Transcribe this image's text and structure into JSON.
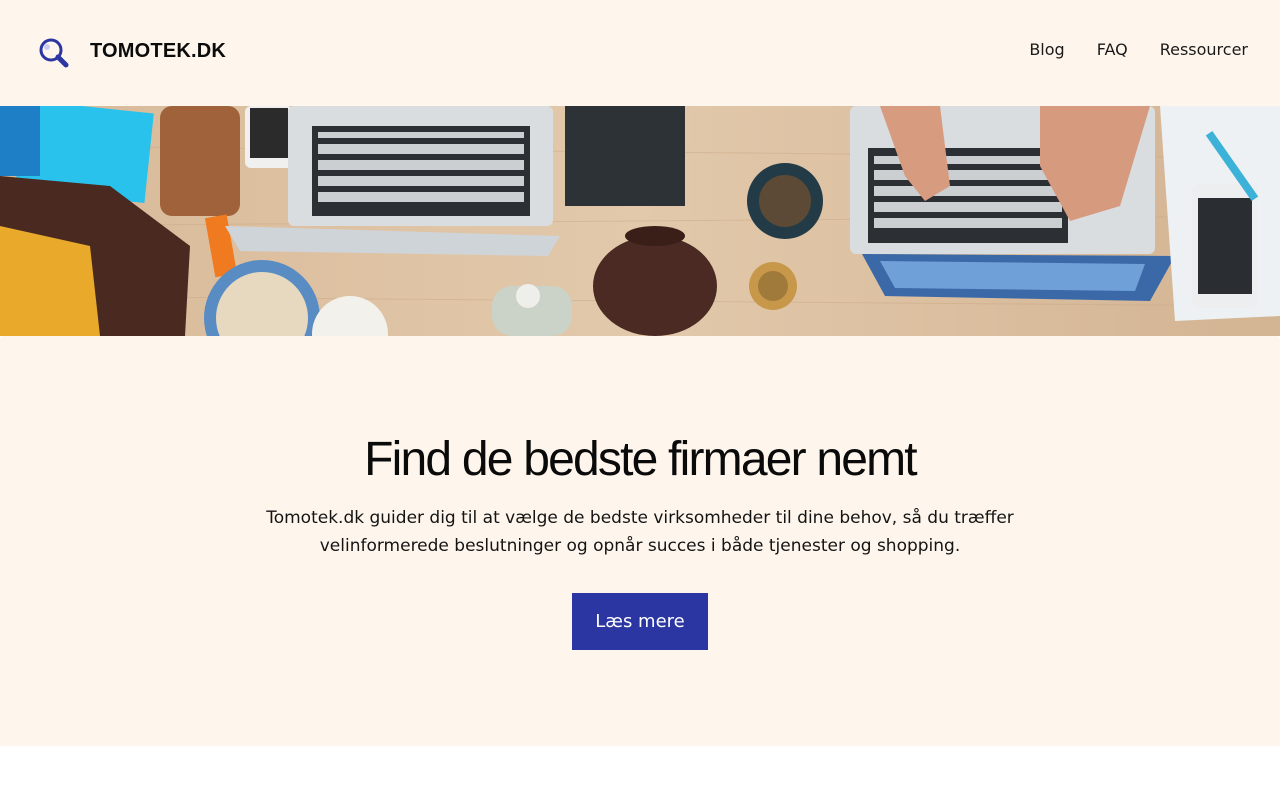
{
  "header": {
    "brand": "TOMOTEK.DK",
    "logo_icon": "magnifier-icon",
    "nav": [
      {
        "label": "Blog"
      },
      {
        "label": "FAQ"
      },
      {
        "label": "Ressourcer"
      }
    ]
  },
  "hero": {
    "image": "desk-workspace-photo",
    "title": "Find de bedste firmaer nemt",
    "description": "Tomotek.dk guider dig til at vælge de bedste virksomheder til dine behov, så du træffer velinformerede beslutninger og opnår succes i både tjenester og shopping.",
    "cta_label": "Læs mere"
  },
  "colors": {
    "header_bg": "#fef6ec",
    "accent": "#2b36a3",
    "text": "#111111"
  }
}
